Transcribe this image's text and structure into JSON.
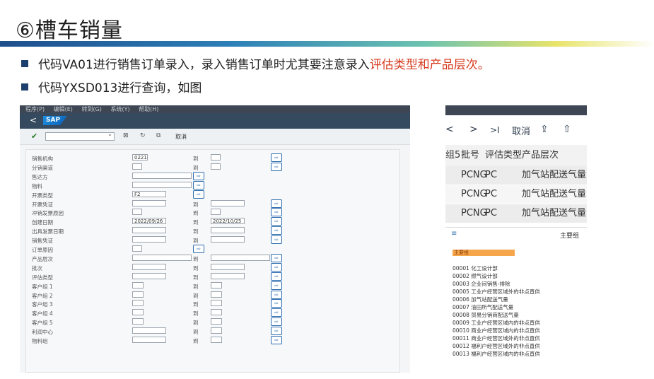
{
  "slide": {
    "title": "⑥槽车销量",
    "bullet1_normal": "代码VA01进行销售订单录入，录入销售订单时尤其要注意录入",
    "bullet1_red": "评估类型和产品层次。",
    "bullet2": "代码YXSD013进行查询，如图"
  },
  "sap": {
    "menu": [
      "程序(P)",
      "编辑(E)",
      "转到(G)",
      "系统(Y)",
      "帮助(H)"
    ],
    "logo": "SAP",
    "back": "<",
    "execute_label": "取消",
    "to_label": "到",
    "rows": [
      {
        "label": "销售机构",
        "from": "0221",
        "has_to": true,
        "to": ""
      },
      {
        "label": "分销渠道",
        "from": "",
        "has_to": true,
        "to": ""
      },
      {
        "label": "售达方",
        "from": "",
        "has_to": false,
        "to": ""
      },
      {
        "label": "物料",
        "from": "",
        "has_to": false,
        "to": ""
      },
      {
        "label": "开票类型",
        "from": "F2",
        "has_to": false,
        "to": ""
      },
      {
        "label": "开票凭证",
        "from": "",
        "has_to": true,
        "to": ""
      },
      {
        "label": "冲销发票原因",
        "from": "",
        "has_to": true,
        "to": ""
      },
      {
        "label": "创建日期",
        "from": "2022/09/26",
        "has_to": true,
        "to": "2022/10/25"
      },
      {
        "label": "出具发票日期",
        "from": "",
        "has_to": true,
        "to": ""
      },
      {
        "label": "销售凭证",
        "from": "",
        "has_to": true,
        "to": ""
      },
      {
        "label": "订单原因",
        "from": "",
        "has_to": false,
        "to": ""
      },
      {
        "label": "产品层次",
        "from": "",
        "has_to": true,
        "to": ""
      },
      {
        "label": "批次",
        "from": "",
        "has_to": true,
        "to": ""
      },
      {
        "label": "评估类型",
        "from": "",
        "has_to": true,
        "to": ""
      },
      {
        "label": "客户组 1",
        "from": "",
        "has_to": true,
        "to": ""
      },
      {
        "label": "客户组 2",
        "from": "",
        "has_to": true,
        "to": ""
      },
      {
        "label": "客户组 3",
        "from": "",
        "has_to": true,
        "to": ""
      },
      {
        "label": "客户组 4",
        "from": "",
        "has_to": true,
        "to": ""
      },
      {
        "label": "客户组 5",
        "from": "",
        "has_to": true,
        "to": ""
      },
      {
        "label": "利润中心",
        "from": "",
        "has_to": true,
        "to": ""
      },
      {
        "label": "物料组",
        "from": "",
        "has_to": true,
        "to": ""
      }
    ]
  },
  "right": {
    "toolbar": {
      "prev": "<",
      "next": ">",
      "last": ">I",
      "cancel": "取消"
    },
    "header": {
      "c0": "组5",
      "c1": "批号",
      "c2": "评估类型",
      "c3": "产品层次"
    },
    "rows": [
      {
        "c1": "PCNG",
        "c2": "PC",
        "c3": "加气站配送气量"
      },
      {
        "c1": "PCNG",
        "c2": "PC",
        "c3": "加气站配送气量"
      },
      {
        "c1": "PCNG",
        "c2": "PC",
        "c3": "加气站配送气量"
      }
    ],
    "group_label": "主要组",
    "list_title": "主要组",
    "list": [
      "00001 化工设计部",
      "00002 燃气设计部",
      "00003 企业间销售-排除",
      "00005 工业户经营区域外的非点直供",
      "00006 加气站配送气量",
      "00007 油田所气配送气量",
      "00008 贸易分销商配送气量",
      "00009 工业户经营区域内的非点直供",
      "00010 商业户经营区域内的非点直供",
      "00011 商业户经营区域外的非点直供",
      "00012 福利户经营区域外的非点直供",
      "00013 福利户经营区域内的非点直供"
    ]
  },
  "colors": {
    "accent_red": "#d63a1e",
    "sap_shell": "#354a5f",
    "bullet_square": "#1d3f6e"
  }
}
